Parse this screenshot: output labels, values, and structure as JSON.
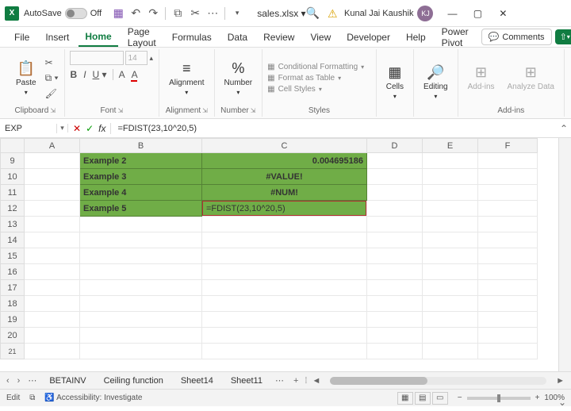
{
  "titlebar": {
    "autosave_label": "AutoSave",
    "autosave_state": "Off",
    "filename": "sales.xlsx ▾",
    "user_name": "Kunal Jai Kaushik",
    "user_initials": "KJ"
  },
  "menu": {
    "items": [
      "File",
      "Insert",
      "Home",
      "Page Layout",
      "Formulas",
      "Data",
      "Review",
      "View",
      "Developer",
      "Help",
      "Power Pivot"
    ],
    "active": "Home",
    "comments": "Comments"
  },
  "ribbon": {
    "paste": "Paste",
    "clipboard": "Clipboard",
    "font": "Font",
    "font_size": "14",
    "alignment_btn": "Alignment",
    "alignment": "Alignment",
    "number_btn": "Number",
    "number": "Number",
    "cond_fmt": "Conditional Formatting",
    "fmt_table": "Format as Table",
    "cell_styles": "Cell Styles",
    "styles": "Styles",
    "cells": "Cells",
    "editing": "Editing",
    "addins": "Add-ins",
    "analyze": "Analyze Data",
    "addins_lbl": "Add-ins"
  },
  "fx": {
    "namebox": "EXP",
    "formula": "=FDIST(23,10^20,5)"
  },
  "grid": {
    "cols": [
      "A",
      "B",
      "C",
      "D",
      "E",
      "F"
    ],
    "rows": [
      "9",
      "10",
      "11",
      "12",
      "13",
      "14",
      "15",
      "16",
      "17",
      "18",
      "19",
      "20",
      "21"
    ],
    "data": {
      "r9_b": "Example 2",
      "r9_c": "0.004695186",
      "r10_b": "Example 3",
      "r10_c": "#VALUE!",
      "r11_b": "Example 4",
      "r11_c": "#NUM!",
      "r12_b": "Example 5",
      "r12_c": "=FDIST(23,10^20,5)"
    }
  },
  "sheets": {
    "nav_dots": "⋯",
    "tabs": [
      "BETAINV",
      "Ceiling function",
      "Sheet14",
      "Sheet11"
    ],
    "more": "⋯"
  },
  "status": {
    "mode": "Edit",
    "accessibility": "Accessibility: Investigate",
    "zoom": "100%"
  }
}
